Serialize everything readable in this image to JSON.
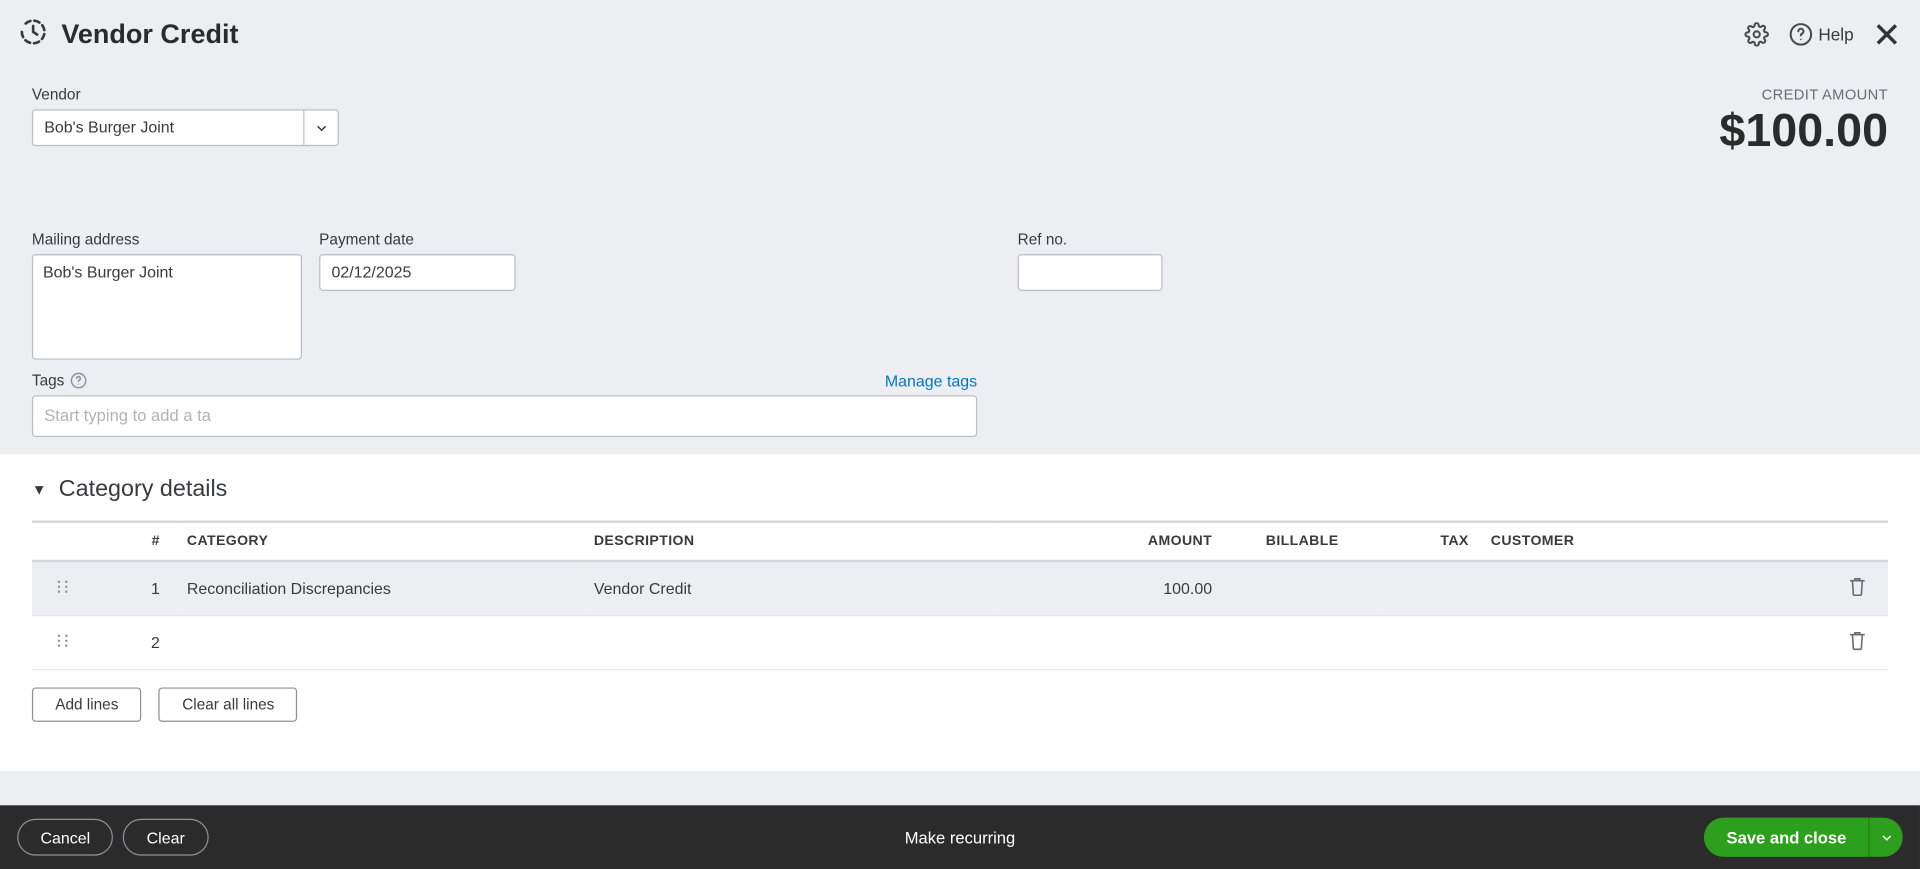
{
  "header": {
    "title": "Vendor Credit",
    "help_label": "Help"
  },
  "vendor": {
    "label": "Vendor",
    "value": "Bob's Burger Joint"
  },
  "credit": {
    "label": "CREDIT AMOUNT",
    "amount": "$100.00"
  },
  "mailing_address": {
    "label": "Mailing address",
    "value": "Bob's Burger Joint"
  },
  "payment_date": {
    "label": "Payment date",
    "value": "02/12/2025"
  },
  "ref_no": {
    "label": "Ref no.",
    "value": ""
  },
  "tags": {
    "label": "Tags",
    "manage": "Manage tags",
    "placeholder": "Start typing to add a ta"
  },
  "category": {
    "title": "Category details",
    "add_lines": "Add lines",
    "clear_all": "Clear all lines",
    "headers": {
      "num": "#",
      "category": "CATEGORY",
      "description": "DESCRIPTION",
      "amount": "AMOUNT",
      "billable": "BILLABLE",
      "tax": "TAX",
      "customer": "CUSTOMER"
    },
    "rows": [
      {
        "num": "1",
        "category": "Reconciliation Discrepancies",
        "description": "Vendor Credit",
        "amount": "100.00",
        "billable": "",
        "tax": "",
        "customer": ""
      },
      {
        "num": "2",
        "category": "",
        "description": "",
        "amount": "",
        "billable": "",
        "tax": "",
        "customer": ""
      }
    ]
  },
  "footer": {
    "cancel": "Cancel",
    "clear": "Clear",
    "recurring": "Make recurring",
    "save": "Save and close"
  }
}
